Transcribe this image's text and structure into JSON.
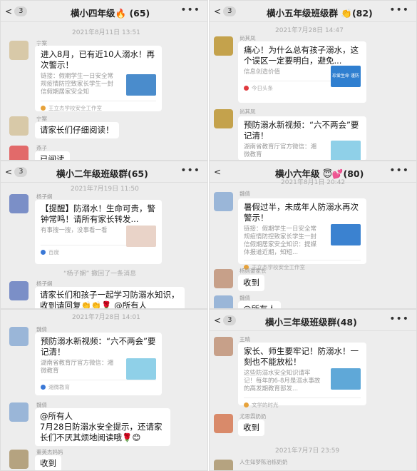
{
  "p1": {
    "back": "3",
    "title": "横小四年级",
    "icon": "🔥",
    "count": "(65)",
    "ts": "2021年8月11日 13:51",
    "m1": {
      "name": "宁案",
      "text": "进入8月，已有近10人溺水！再次警示！",
      "desc": "链接：假期学生一日安全常规疫情防控致家长学生一封信假期居家安全知",
      "src": "王立杰学校安全工作室"
    },
    "m2": {
      "name": "宁案",
      "text": "请家长们仔细阅读！"
    },
    "m3": {
      "name": "燕子",
      "text": "已阅读"
    }
  },
  "p2": {
    "back": "3",
    "title": "横小五年级班级群",
    "icon": "👏",
    "count": "(82)",
    "ts": "2021年7月28日 14:47",
    "m1": {
      "name": "尚其凤",
      "text": "痛心！为什么总有孩子溺水，这个误区一定要明白，避免...",
      "desc": "信息创造价值",
      "src": "今日头条",
      "thumb": "珍爱生命 谨防溺水"
    },
    "m2": {
      "name": "尚其凤",
      "text": "预防溺水新视频：“六不两会”要记清！",
      "desc": "湖南省教育厅官方微信：湘微教育"
    }
  },
  "p3": {
    "back": "3",
    "title": "横小二年级班级群",
    "count": "(65)",
    "ts": "2021年7月19日 11:50",
    "m1": {
      "name": "杨子娴",
      "text": "【提醒】防溺水！生命可贵，警钟常鸣！请所有家长转发...",
      "desc": "有事搜一搜，没事看一看",
      "src": "百度"
    },
    "recall": "“杨子娴” 撤回了一条消息",
    "m2": {
      "name": "杨子娴",
      "text": "请家长们和孩子一起学习防溺水知识，收到请回复👏👏🌹 @所有人"
    }
  },
  "p4": {
    "back": "",
    "title": "横小六年级",
    "icon": "😇💕",
    "count": "(80)",
    "ts": "2021年8月1日 20:42",
    "m1": {
      "name": "魏倩",
      "text": "暑假过半，未成年人防溺水再次警示！",
      "desc": "链接：假期学生一日安全常规疫情防控致家长学生一封信假期居家安全知识：提媒体报道近期，知短...",
      "src": "王立杰学校安全工作室"
    },
    "m2": {
      "name": "杨则豪家长",
      "text": "收到"
    },
    "m3": {
      "name": "魏倩",
      "text": "@所有人"
    }
  },
  "p5": {
    "ts": "2021年7月28日 14:01",
    "m1": {
      "name": "魏倩",
      "text": "预防溺水新视频：“六不两会”要记清！",
      "desc": "湖南省教育厅官方微信：湘微教育",
      "src": "湘微教育"
    },
    "m2": {
      "name": "魏倩",
      "text": "@所有人\n7月28日防溺水安全提示，还请家长们不厌其烦地阅读哦🌹😊"
    },
    "m3": {
      "name": "董英杰妈妈",
      "text": "收到"
    }
  },
  "p6": {
    "back": "3",
    "title": "横小三年级班级群",
    "count": "(48)",
    "m1": {
      "name": "王晴",
      "text": "家长、师生要牢记！防溺水！一刻也不能放松！",
      "desc": "这些防溺水安全知识请牢记！每年的6-8月是溺水事故的高发期教育部发...",
      "src": "文学的时光"
    },
    "m2": {
      "name": "尤思霖奶奶",
      "text": "收到"
    },
    "ts": "2021年7月7日 23:59",
    "m3": {
      "name": "人生知梦陈治栋奶奶"
    }
  },
  "colors": {
    "bg": "#ededed",
    "bubble": "#ffffff",
    "text": "#111111",
    "meta": "#999999"
  }
}
